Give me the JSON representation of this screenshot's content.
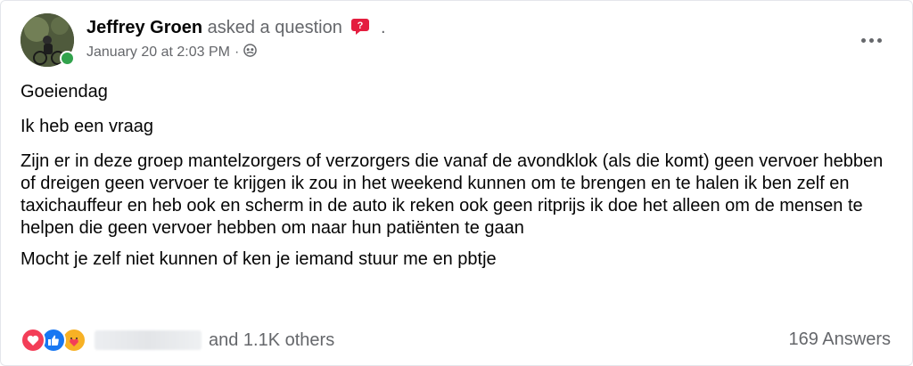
{
  "post": {
    "author": "Jeffrey Groen",
    "action": "asked a question",
    "action_icon": "question-badge-icon",
    "trailing_dot": ".",
    "timestamp": "January 20 at 2:03 PM",
    "separator": "·",
    "audience_icon": "group-audience-icon",
    "paragraphs": [
      "Goeiendag",
      "Ik heb een vraag",
      "Zijn er in deze groep mantelzorgers of verzorgers die vanaf de avondklok (als die komt) geen vervoer hebben of dreigen geen vervoer te krijgen ik zou in het weekend kunnen om te brengen en te halen ik ben zelf en taxichauffeur en heb ook en scherm in de auto ik reken ook geen ritprijs ik doe het alleen om de mensen te helpen die geen vervoer hebben om naar hun patiënten te gaan",
      "Mocht je zelf niet kunnen of ken je iemand stuur me en pbtje"
    ]
  },
  "footer": {
    "reactions": [
      "love-reaction-icon",
      "like-reaction-icon",
      "care-reaction-icon"
    ],
    "others_text": "and 1.1K others",
    "answers_text": "169 Answers"
  },
  "colors": {
    "secondary_text": "#65676b",
    "primary_text": "#050505",
    "online": "#31a24c",
    "love": "#f33e58",
    "like": "#1877f2",
    "care": "#f7b125",
    "question_badge": "#e41e3f"
  }
}
